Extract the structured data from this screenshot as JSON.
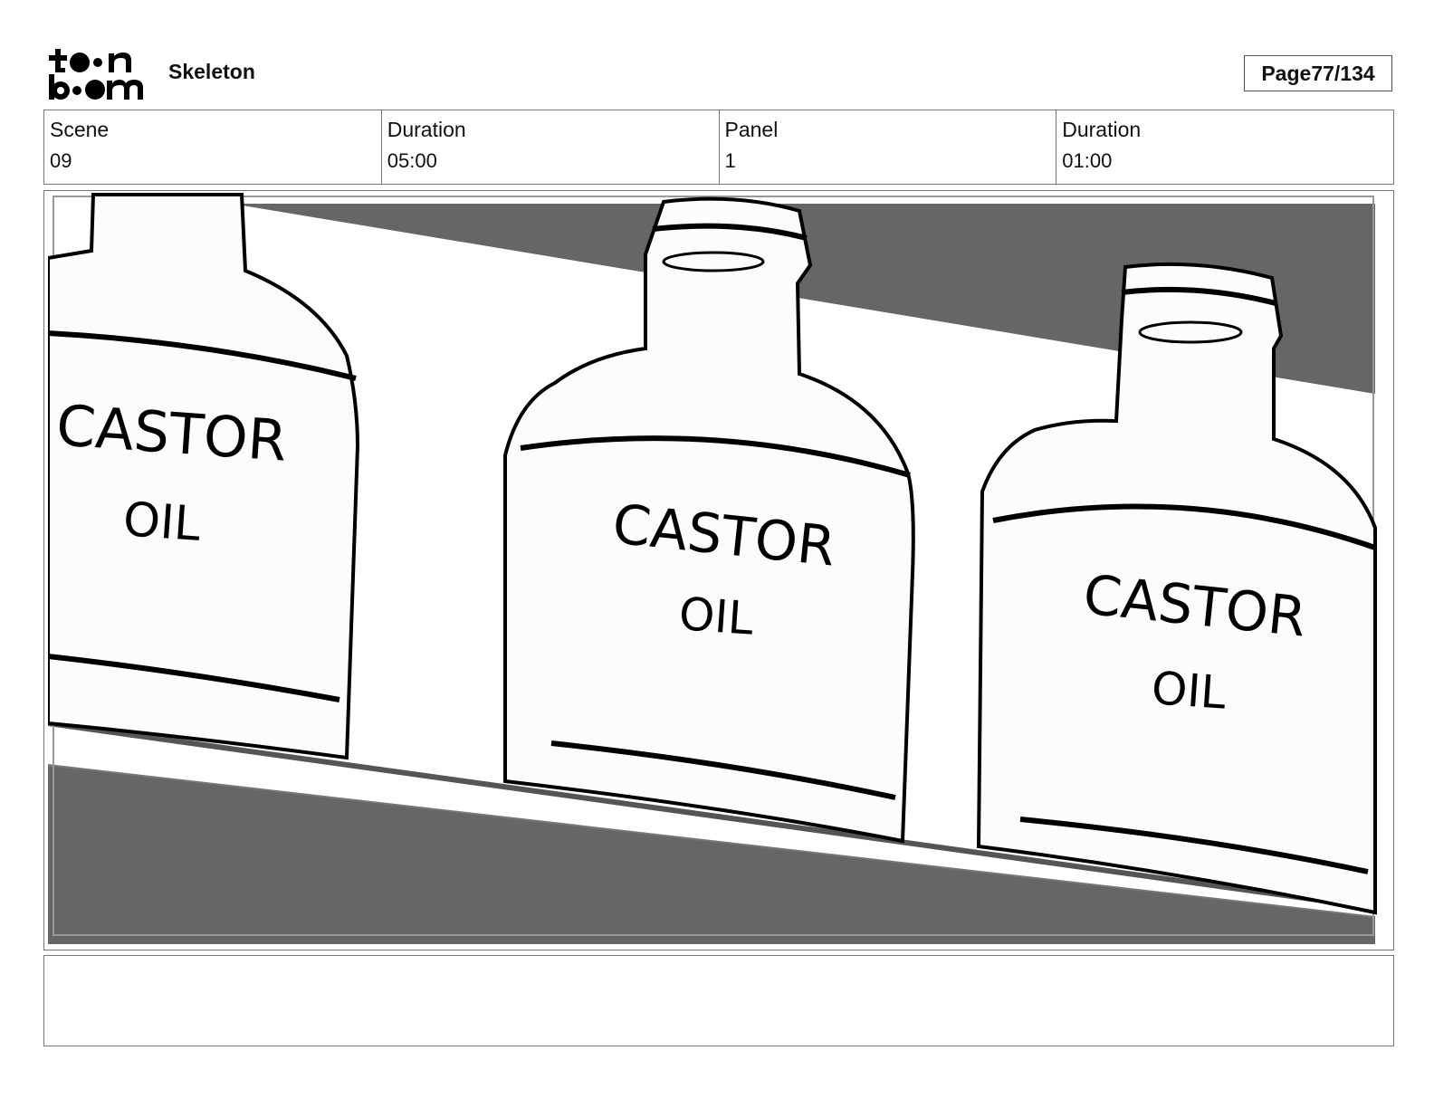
{
  "header": {
    "logo_text": "toonboom",
    "project_title": "Skeleton",
    "page_label": "Page",
    "page_number": "77/134"
  },
  "info": [
    {
      "label": "Scene",
      "value": "09"
    },
    {
      "label": "Duration",
      "value": "05:00"
    },
    {
      "label": "Panel",
      "value": "1"
    },
    {
      "label": "Duration",
      "value": "01:00"
    }
  ],
  "panel": {
    "bottle_label_line1": "CASTOR",
    "bottle_label_line2": "OIL"
  },
  "notes": {
    "text": ""
  },
  "colors": {
    "shadow_gray": "#666666",
    "bottle_fill": "#fcfbfd",
    "ink": "#000000",
    "frame_border": "#777777"
  }
}
